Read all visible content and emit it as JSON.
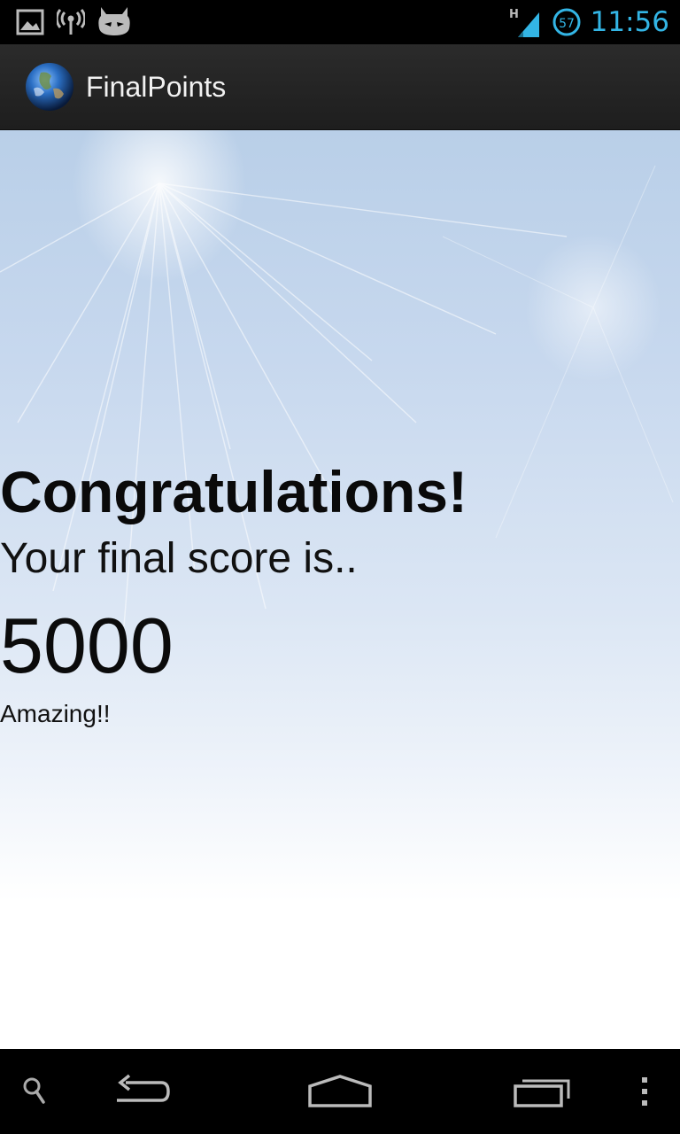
{
  "status_bar": {
    "time": "11:56",
    "network_type": "H",
    "notification_count": "57",
    "left_icons": [
      "image-notification-icon",
      "wireless-broadcast-icon",
      "cyanogen-mascot-icon"
    ],
    "accent": "#33b5e5"
  },
  "action_bar": {
    "title": "FinalPoints",
    "icon": "earth-icon"
  },
  "content": {
    "headline": "Congratulations!",
    "subtitle": "Your final score is..",
    "score": "5000",
    "rating": "Amazing!!"
  },
  "nav_bar": {
    "buttons": [
      "search-icon",
      "back-icon",
      "home-icon",
      "recent-apps-icon",
      "menu-icon"
    ]
  }
}
